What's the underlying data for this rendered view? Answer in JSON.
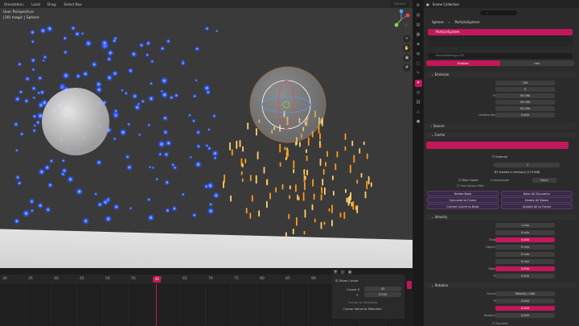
{
  "viewport": {
    "header": {
      "orientation_label": "Orientation:",
      "transform_space": "Local",
      "drag_label": "Drag:",
      "select_mode": "Select Box",
      "options_label": "Options"
    },
    "view_name": "User Perspective",
    "object_info": "(30) magic | Sphere",
    "nav_icons": [
      "zoom-icon",
      "hand-icon",
      "camera-icon",
      "grid-icon"
    ]
  },
  "properties": {
    "outliner_title": "Scene Collection",
    "breadcrumb": [
      "Sphere",
      "ParticleSystem"
    ],
    "particle_system_name": "ParticleSystem",
    "settings_name": "ParticleSettings.003",
    "type_tabs": [
      "Emitter",
      "Hair"
    ],
    "sections": {
      "emission": "Emission",
      "source": "Source",
      "cache": "Cache",
      "velocity": "Velocity",
      "rotation": "Rotation"
    },
    "emission_props": [
      {
        "label": "Number",
        "value": "150"
      },
      {
        "label": "Seed",
        "value": "0"
      },
      {
        "label": "Frame Start",
        "value": "55.000"
      },
      {
        "label": "End",
        "value": "55.000"
      },
      {
        "label": "Lifetime",
        "value": "55.000"
      },
      {
        "label": "Lifetime Randomness",
        "value": "0.000"
      }
    ],
    "cache": {
      "external_label": "External",
      "cache_step_label": "Cache Step",
      "cache_step_value": "1",
      "frames_info": "61 frames in memory (173 KiB)",
      "disk_cache_label": "Disk Cache",
      "compression_label": "Compression",
      "compression_value": "None",
      "use_library_path": "Use Library Path",
      "buttons": [
        "Delete Bake",
        "Bake All Dynamics",
        "Calculate to Frame",
        "Delete All Bakes",
        "Current Cache to Bake",
        "Update All to Frame"
      ]
    },
    "velocity_props": [
      {
        "label": "Normal",
        "value": "1 m/s"
      },
      {
        "label": "Tangent",
        "value": "0 m/s"
      },
      {
        "label": "Tangent Phase",
        "value": "0.000"
      },
      {
        "label": "Object Aligned X",
        "value": "0 m/s"
      },
      {
        "label": "Y",
        "value": "0 m/s"
      },
      {
        "label": "Z",
        "value": "0 m/s"
      },
      {
        "label": "Object Velocity",
        "value": "0.000"
      },
      {
        "label": "Randomize",
        "value": "0.000"
      }
    ],
    "rotation_props": [
      {
        "label": "Orientation Axis",
        "value": "Velocity / Hair"
      },
      {
        "label": "Randomize",
        "value": "0.000"
      },
      {
        "label": "Phase",
        "value": "0.000"
      },
      {
        "label": "Randomize Phase",
        "value": "0.000"
      }
    ],
    "rotation_dynamic": "Dynamic"
  },
  "timeline": {
    "frames": [
      "30",
      "35",
      "40",
      "45",
      "50",
      "55",
      "60",
      "65",
      "70",
      "75",
      "80",
      "85",
      "90"
    ],
    "current_frame": "43",
    "show_cursor_label": "Show Cursor",
    "cursor_x_label": "Cursor X",
    "cursor_x_value": "43",
    "cursor_y_label": "Y",
    "cursor_y_value": "0.000",
    "cursor_to_selection": "Cursor to Selection",
    "cursor_value_to_selection": "Cursor Value to Selection",
    "side_tabs": [
      "View",
      "Extensible",
      "Tool"
    ]
  },
  "colors": {
    "accent": "#c2185b",
    "blue_particles": "#3a6cff",
    "orange_particles": "#ffaa22"
  }
}
